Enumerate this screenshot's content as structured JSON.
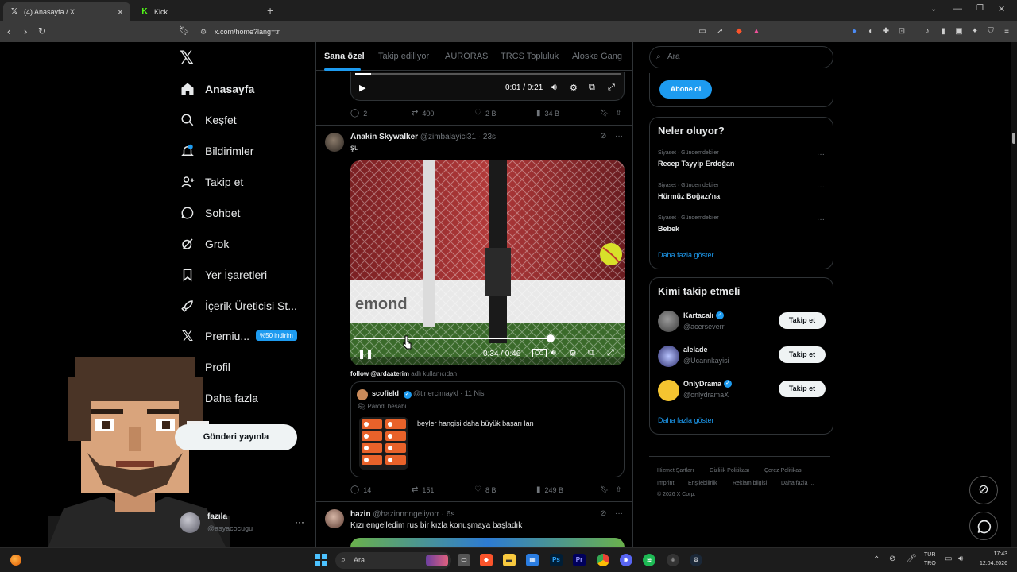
{
  "browser": {
    "tabs": [
      {
        "label": "(4) Anasayfa / X",
        "active": true
      },
      {
        "label": "Kick",
        "active": false
      }
    ],
    "url": "x.com/home?lang=tr"
  },
  "nav": {
    "items": [
      {
        "label": "Anasayfa"
      },
      {
        "label": "Keşfet"
      },
      {
        "label": "Bildirimler"
      },
      {
        "label": "Takip et"
      },
      {
        "label": "Sohbet"
      },
      {
        "label": "Grok"
      },
      {
        "label": "Yer İşaretleri"
      },
      {
        "label": "İçerik Üreticisi St..."
      },
      {
        "label": "Premiu..."
      },
      {
        "label": "Profil"
      },
      {
        "label": "Daha fazla"
      }
    ],
    "premium_badge": "%50 indirim",
    "post_button": "Gönderi yayınla",
    "account": {
      "name": "fazıla",
      "handle": "@asyacocugu"
    }
  },
  "feed": {
    "tabs": [
      "Sana özel",
      "Takip edilİyor",
      "AURORAS",
      "TRCS Topluluk",
      "Aloske Gang"
    ],
    "post0": {
      "video_time": "0:01 / 0:21",
      "replies": "2",
      "reposts": "400",
      "likes": "2 B",
      "views": "34 B"
    },
    "post1": {
      "author": "Anakin Skywalker",
      "handle": "@zimbalayici31 · 23s",
      "text": "şu",
      "video_time": "0:34 / 0:46",
      "video_progress": 0.74,
      "video_watermark": "emond",
      "caption_bold": "follow @ardaaterim",
      "caption_rest": "adlı kullanıcıdan",
      "quote": {
        "author": "scofield",
        "handle": "@tinercimaykl · 11 Nis",
        "parody": "Parodi hesabı",
        "text": "beyler hangisi daha büyük başarı lan"
      },
      "replies": "14",
      "reposts": "151",
      "likes": "8 B",
      "views": "249 B"
    },
    "post2": {
      "author": "hazin",
      "handle": "@hazinnnngeliyorr · 6s",
      "text": "Kızı engelledim rus bir kızla konuşmaya başladık"
    }
  },
  "right": {
    "search_placeholder": "Ara",
    "subscribe": "Abone ol",
    "trends_title": "Neler oluyor?",
    "trends": [
      {
        "category": "Siyaset · Gündemdekiler",
        "name": "Recep Tayyip Erdoğan"
      },
      {
        "category": "Siyaset · Gündemdekiler",
        "name": "Hürmüz Boğazı'na"
      },
      {
        "category": "Siyaset · Gündemdekiler",
        "name": "Bebek"
      }
    ],
    "show_more": "Daha fazla göster",
    "wtf_title": "Kimi takip etmeli",
    "follow_label": "Takip et",
    "suggestions": [
      {
        "name": "Kartacalı",
        "handle": "@acerseverr",
        "verified": true
      },
      {
        "name": "alelade",
        "handle": "@Ucannkayisi",
        "verified": false
      },
      {
        "name": "OnlyDrama",
        "handle": "@onlydramaX",
        "verified": true
      }
    ],
    "footer": [
      "Hizmet Şartları",
      "Gizlilik Politikası",
      "Çerez Politikası",
      "Imprint",
      "Erişilebilirlik",
      "Reklam bilgisi",
      "Daha fazla ...",
      "© 2026 X Corp."
    ]
  },
  "taskbar": {
    "search": "Ara",
    "lang": "TUR",
    "lang2": "TRQ",
    "time": "17:43",
    "date": "12.04.2026"
  },
  "colors": {
    "accent": "#1d9bf0",
    "background": "#000000",
    "border": "#2f3336"
  }
}
